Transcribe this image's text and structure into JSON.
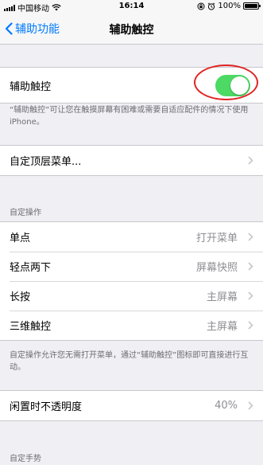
{
  "status_bar": {
    "carrier": "中国移动",
    "time": "16:14",
    "battery": "100%"
  },
  "nav": {
    "back_label": "辅助功能",
    "title": "辅助触控"
  },
  "toggle_row": {
    "label": "辅助触控",
    "state": "on"
  },
  "toggle_footer": "“辅助触控”可让您在触摸屏幕有困难或需要自适应配件的情况下使用 iPhone。",
  "custom_menu": {
    "label": "自定顶层菜单..."
  },
  "custom_actions": {
    "header": "自定操作",
    "rows": [
      {
        "label": "单点",
        "value": "打开菜单"
      },
      {
        "label": "轻点两下",
        "value": "屏幕快照"
      },
      {
        "label": "长按",
        "value": "主屏幕"
      },
      {
        "label": "三维触控",
        "value": "主屏幕"
      }
    ],
    "footer": "自定操作允许您无需打开菜单，通过“辅助触控”图标即可直接进行互动。"
  },
  "idle_opacity": {
    "label": "闲置时不透明度",
    "value": "40%"
  },
  "custom_gestures": {
    "header": "自定手势"
  },
  "colors": {
    "accent": "#007aff",
    "toggle_on": "#4cd964",
    "highlight_circle": "#e02424",
    "background": "#efeff4"
  }
}
